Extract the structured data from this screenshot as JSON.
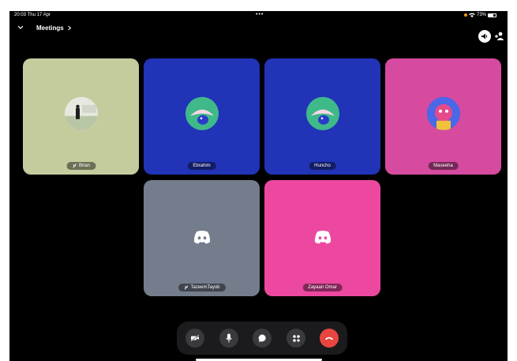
{
  "statusbar": {
    "time": "20:03",
    "date": "Thu 17 Apr",
    "dots": "•••",
    "battery": "73%"
  },
  "header": {
    "title": "Meetings"
  },
  "participants": [
    {
      "name": "Brian",
      "muted": true,
      "bg": "#c4cc9e"
    },
    {
      "name": "Ebrahim",
      "muted": false,
      "bg": "#2133b6"
    },
    {
      "name": "Huncho",
      "muted": false,
      "bg": "#2133b6"
    },
    {
      "name": "Maseeha",
      "muted": false,
      "bg": "#d64aa0"
    },
    {
      "name": "TazeemTayob",
      "muted": true,
      "bg": "#737d8c"
    },
    {
      "name": "Zayaan Omar",
      "muted": false,
      "bg": "#ec48a0"
    }
  ],
  "controls": [
    "camera-off-button",
    "microphone-button",
    "chat-button",
    "activities-button",
    "end-call-button"
  ],
  "colors": {
    "end_call": "#e7463f",
    "dock": "#1b1b1d"
  }
}
